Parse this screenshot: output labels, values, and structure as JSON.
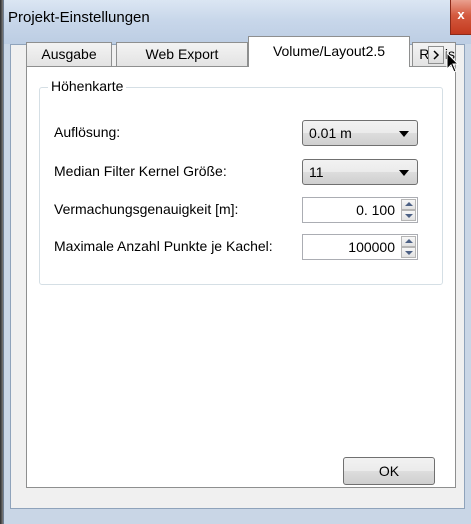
{
  "window": {
    "title": "Projekt-Einstellungen",
    "close_label": "x"
  },
  "tabs": [
    {
      "label": "Ausgabe",
      "active": false
    },
    {
      "label": "Web Export",
      "active": false
    },
    {
      "label": "Volume/Layout2.5",
      "active": true
    },
    {
      "label": "Regis",
      "active": false
    }
  ],
  "heightmap": {
    "group_title": "Höhenkarte",
    "resolution": {
      "label": "Auflösung:",
      "value": "0.01 m"
    },
    "median_filter": {
      "label": "Median Filter Kernel Größe:",
      "value": "11"
    },
    "meshing_accuracy": {
      "label": "Vermachungsgenauigkeit [m]:",
      "value": "0. 100"
    },
    "max_points": {
      "label": "Maximale Anzahl Punkte je Kachel:",
      "value": "100000"
    }
  },
  "buttons": {
    "ok_label": "OK"
  },
  "icons": {
    "close": "close-icon",
    "tab_scroll": "chevron-right-icon",
    "combo_arrow": "chevron-down-icon",
    "spin_up": "arrow-up-icon",
    "spin_down": "arrow-down-icon",
    "cursor": "mouse-cursor-icon"
  }
}
